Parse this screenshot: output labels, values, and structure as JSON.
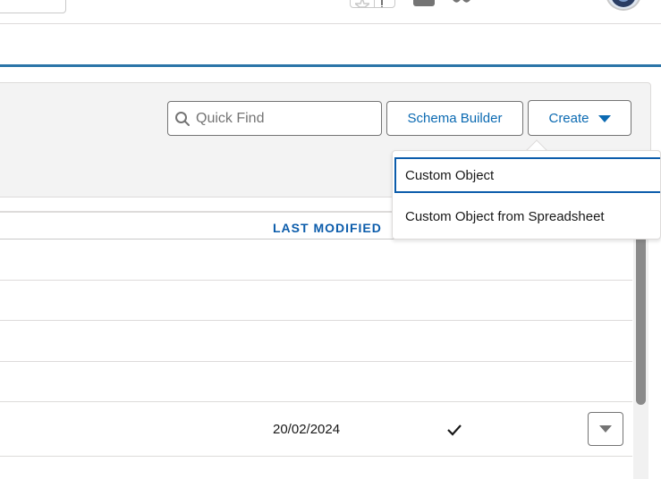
{
  "header": {
    "icons": [
      "star-icon",
      "list-icon",
      "plus-icon",
      "trailhead-icon",
      "help-icon",
      "gear-icon",
      "bell-icon"
    ]
  },
  "toolbar": {
    "quick_find_placeholder": "Quick Find",
    "schema_builder_label": "Schema Builder",
    "create_label": "Create"
  },
  "create_menu": {
    "items": [
      {
        "label": "Custom Object"
      },
      {
        "label": "Custom Object from Spreadsheet"
      }
    ]
  },
  "table": {
    "columns": {
      "last_modified": "LAST MODIFIED"
    },
    "rows": [
      {
        "last_modified": ""
      },
      {
        "last_modified": ""
      },
      {
        "last_modified": ""
      },
      {
        "last_modified": ""
      },
      {
        "last_modified": "20/02/2024",
        "deployed": true
      }
    ]
  },
  "colors": {
    "accent": "#0b5cab",
    "link": "#0b6ab2",
    "tab_rule": "#2b74a8"
  }
}
